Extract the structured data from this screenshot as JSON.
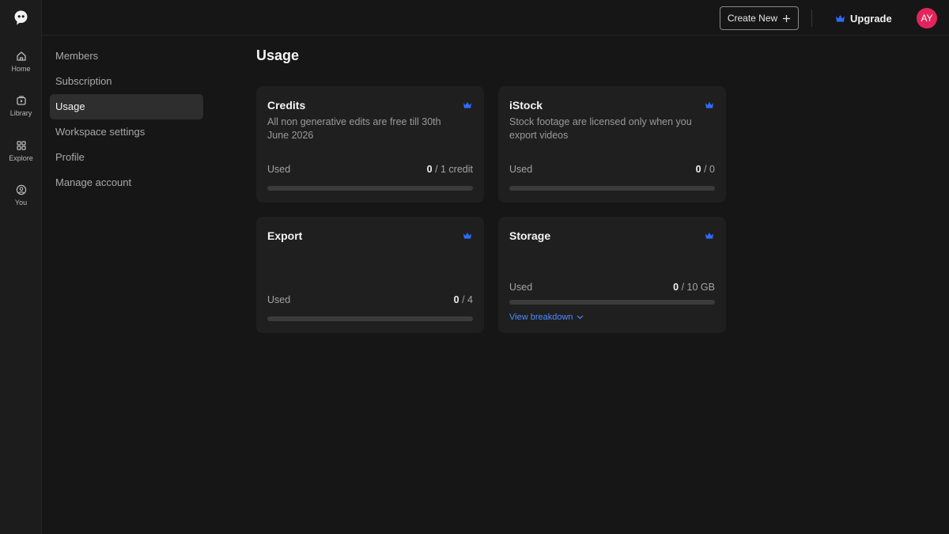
{
  "rail": {
    "items": [
      {
        "label": "Home",
        "icon": "home-icon"
      },
      {
        "label": "Library",
        "icon": "library-icon"
      },
      {
        "label": "Explore",
        "icon": "grid-icon"
      },
      {
        "label": "You",
        "icon": "user-circle-icon"
      }
    ]
  },
  "topbar": {
    "create_label": "Create New",
    "upgrade_label": "Upgrade",
    "avatar_initials": "AY"
  },
  "settings_nav": {
    "items": [
      "Members",
      "Subscription",
      "Usage",
      "Workspace settings",
      "Profile",
      "Manage account"
    ],
    "active": "Usage"
  },
  "main": {
    "title": "Usage",
    "cards": [
      {
        "title": "Credits",
        "desc": "All non generative edits are free till 30th June 2026",
        "used_label": "Used",
        "used": "0",
        "limit": "/ 1 credit",
        "progress": 0
      },
      {
        "title": "iStock",
        "desc": "Stock footage are licensed only when you export videos",
        "used_label": "Used",
        "used": "0",
        "limit": "/ 0",
        "progress": 0
      },
      {
        "title": "Export",
        "desc": "",
        "used_label": "Used",
        "used": "0",
        "limit": "/ 4",
        "progress": 0
      },
      {
        "title": "Storage",
        "desc": "",
        "used_label": "Used",
        "used": "0",
        "limit": "/ 10 GB",
        "progress": 0,
        "link": "View breakdown"
      }
    ]
  },
  "colors": {
    "background": "#161616",
    "card": "#1f1f1f",
    "accent": "#4f8bff",
    "crown": "#2f6bff",
    "avatar": "#e3245c"
  }
}
